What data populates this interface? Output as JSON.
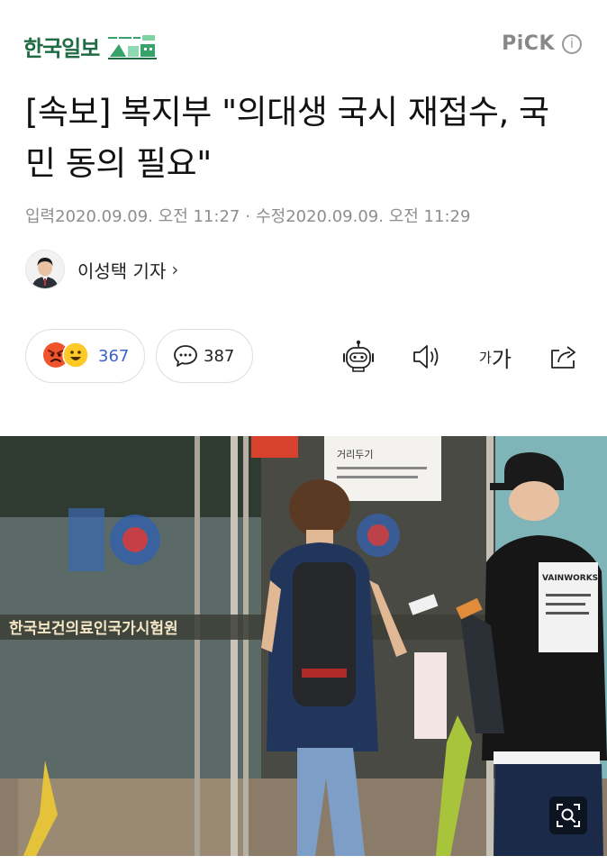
{
  "header": {
    "press_name": "한국일보",
    "pick_label": "PiCK",
    "info_icon": "info-icon"
  },
  "article": {
    "headline": "[속보] 복지부 \"의대생 국시 재접수, 국민 동의 필요\"",
    "published_label": "입력",
    "published": "2020.09.09. 오전 11:27",
    "separator": "·",
    "modified_label": "수정",
    "modified": "2020.09.09. 오전 11:29",
    "author": "이성택 기자",
    "author_chevron": "›"
  },
  "engagement": {
    "reaction_count": "367",
    "comment_count": "387",
    "emoji_icons": [
      "angry-face-icon",
      "smiling-face-icon"
    ]
  },
  "toolbar": {
    "icons": [
      "robot-summary-icon",
      "speaker-icon",
      "font-size-icon",
      "share-icon"
    ],
    "font_small": "가",
    "font_large": "가"
  },
  "photo": {
    "building_sign": "한국보건의료인국가시험원",
    "notice_text": "거리두기",
    "shirt_text": "VAINWORKS",
    "zoom_icon": "zoom-icon"
  },
  "colors": {
    "press_green": "#1f6b43",
    "reaction_blue": "#3d5fd0",
    "muted_gray": "#8e8e8e"
  }
}
